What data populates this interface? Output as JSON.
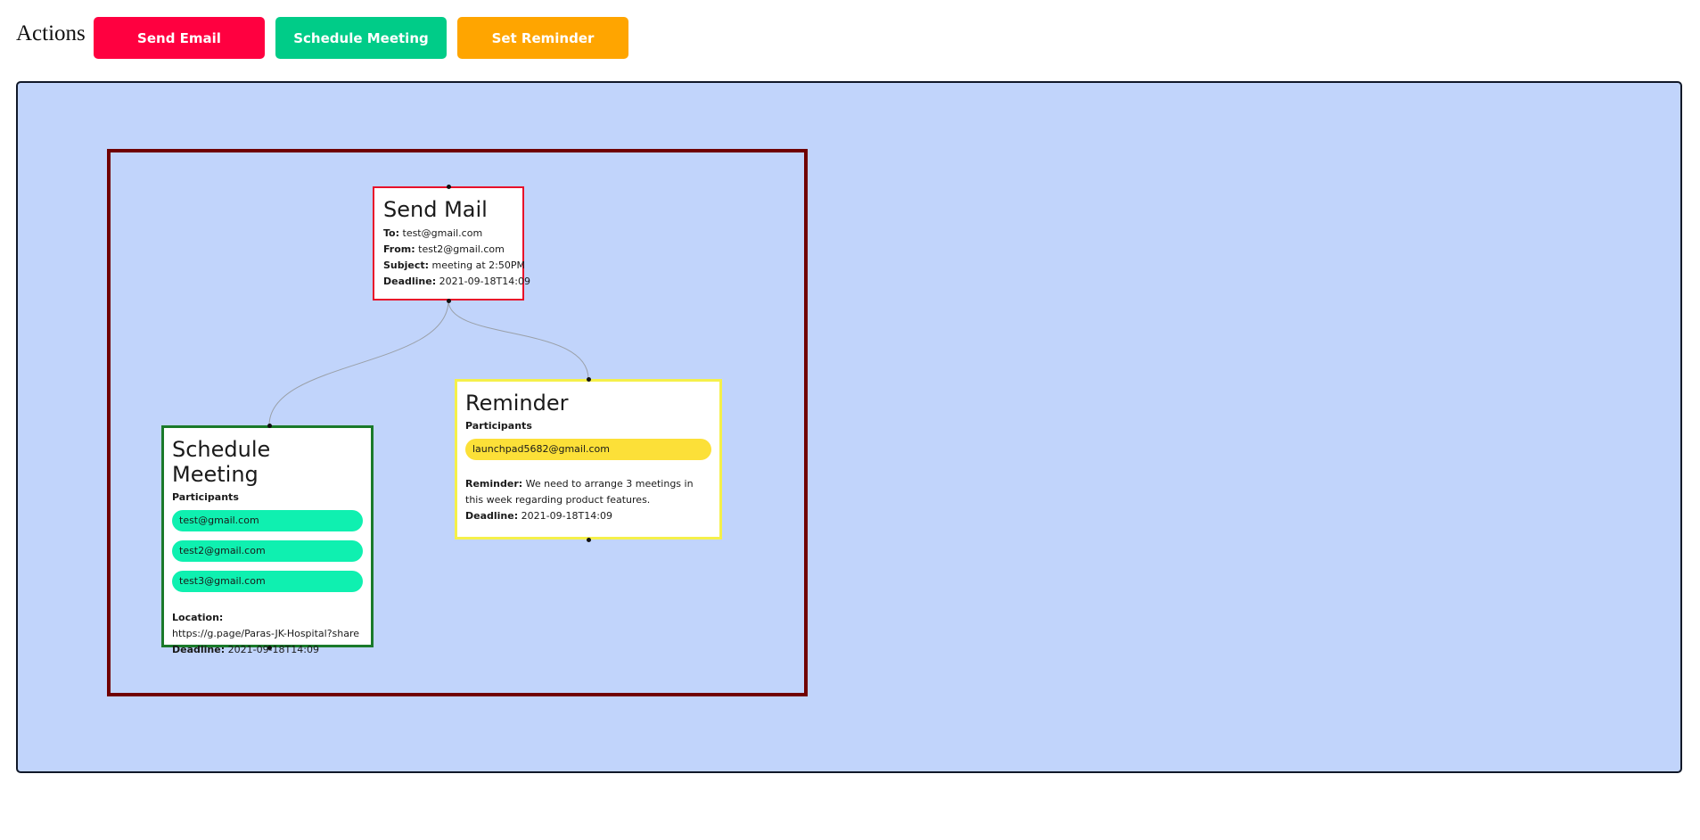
{
  "header": {
    "title": "Actions",
    "buttons": {
      "send_email": "Send Email",
      "schedule_meeting": "Schedule Meeting",
      "set_reminder": "Set Reminder"
    }
  },
  "colors": {
    "send_email": "#ff0040",
    "schedule_meeting": "#00cc88",
    "set_reminder": "#ffa500",
    "canvas_bg": "#c1d4fb",
    "group_border": "#700000"
  },
  "nodes": {
    "mail": {
      "title": "Send Mail",
      "to_label": "To:",
      "to": "test@gmail.com",
      "from_label": "From:",
      "from": "test2@gmail.com",
      "subject_label": "Subject:",
      "subject": "meeting at 2:50PM",
      "deadline_label": "Deadline:",
      "deadline": "2021-09-18T14:09"
    },
    "meeting": {
      "title": "Schedule Meeting",
      "participants_label": "Participants",
      "participants": [
        "test@gmail.com",
        "test2@gmail.com",
        "test3@gmail.com"
      ],
      "location_label": "Location:",
      "location": "https://g.page/Paras-JK-Hospital?share",
      "deadline_label": "Deadline:",
      "deadline": "2021-09-18T14:09"
    },
    "reminder": {
      "title": "Reminder",
      "participants_label": "Participants",
      "participants": [
        "launchpad5682@gmail.com"
      ],
      "reminder_label": "Reminder:",
      "reminder": "We need to arrange 3 meetings in this week regarding product features.",
      "deadline_label": "Deadline:",
      "deadline": "2021-09-18T14:09"
    }
  }
}
